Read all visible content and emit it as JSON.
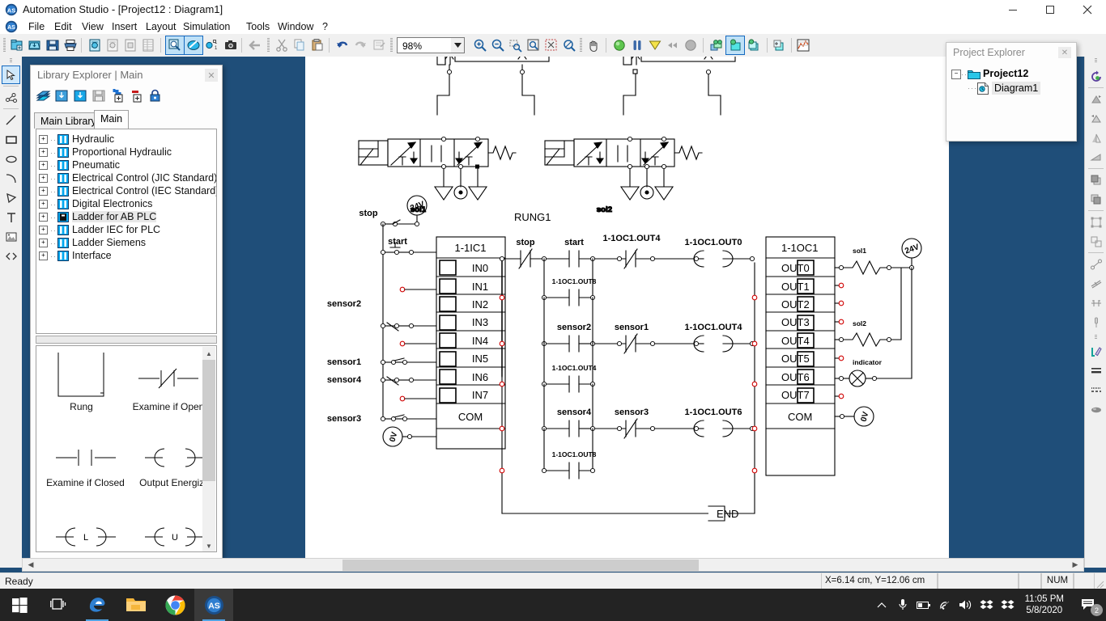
{
  "window": {
    "title": "Automation Studio - [Project12 : Diagram1]",
    "minimize": "–",
    "maximize": "❐",
    "close": "✕"
  },
  "menu": {
    "items": [
      "File",
      "Edit",
      "View",
      "Insert",
      "Layout",
      "Simulation",
      "Tools",
      "Window",
      "?"
    ]
  },
  "toolbar": {
    "zoom_value": "98%",
    "icons": [
      "new-project-icon",
      "open-project-icon",
      "save-icon",
      "print-icon",
      "new-diagram-icon",
      "new-report-icon",
      "new-document-icon",
      "report-table-icon",
      "zoom-preview-icon",
      "edit-mode-icon",
      "variable-manager-icon",
      "snapshot-icon",
      "back-icon",
      "cut-icon",
      "copy-icon",
      "paste-icon",
      "undo-icon",
      "redo-icon",
      "properties-icon",
      "zoom-in-icon",
      "zoom-out-icon",
      "zoom-region-icon",
      "zoom-page-icon",
      "zoom-fit-icon",
      "zoom-select-icon",
      "pan-hand-icon",
      "simulation-normal-icon",
      "simulation-step-icon",
      "simulation-slow-icon",
      "simulation-pause-icon",
      "simulation-stop-icon",
      "sequence-diagram-icon",
      "new-layer-icon",
      "copy-layer-icon",
      "add-layer-icon",
      "plot-graph-icon"
    ]
  },
  "left_tools": {
    "items": [
      {
        "name": "select-arrow-tool",
        "selected": true
      },
      {
        "name": "link-connection-tool",
        "selected": false
      },
      {
        "name": "line-tool",
        "selected": false
      },
      {
        "name": "rectangle-tool",
        "selected": false
      },
      {
        "name": "ellipse-tool",
        "selected": false
      },
      {
        "name": "arc-tool",
        "selected": false
      },
      {
        "name": "polygon-tool",
        "selected": false
      },
      {
        "name": "text-tool",
        "selected": false
      },
      {
        "name": "image-tool",
        "selected": false
      },
      {
        "name": "code-tool",
        "selected": false
      }
    ]
  },
  "right_tools": {
    "items": [
      "refresh-simulation-icon",
      "align-top-icon",
      "align-bottom-icon",
      "flip-vertical-icon",
      "flip-horizontal-icon",
      "bring-front-icon",
      "send-back-icon",
      "group-icon",
      "ungroup-icon",
      "measure-line-icon",
      "parallel-icon",
      "distribute-icon",
      "pin-icon",
      "pen-color-icon",
      "line-weight-icon",
      "line-style-icon",
      "fill-color-icon"
    ]
  },
  "library_explorer": {
    "title": "Library Explorer | Main",
    "close_label": "✕",
    "toolbar_icons": [
      "open-library-icon",
      "import-library-icon",
      "export-library-icon",
      "save-library-icon",
      "add-component-icon",
      "remove-component-icon",
      "lock-library-icon"
    ],
    "tabs": [
      {
        "label": "Main Library",
        "active": false
      },
      {
        "label": "Main",
        "active": true
      }
    ],
    "tree": [
      {
        "label": "Hydraulic",
        "selected": false
      },
      {
        "label": "Proportional Hydraulic",
        "selected": false
      },
      {
        "label": "Pneumatic",
        "selected": false
      },
      {
        "label": "Electrical Control (JIC Standard)",
        "selected": false
      },
      {
        "label": "Electrical Control (IEC Standard)",
        "selected": false
      },
      {
        "label": "Digital Electronics",
        "selected": false
      },
      {
        "label": "Ladder for AB PLC",
        "selected": true
      },
      {
        "label": "Ladder IEC for PLC",
        "selected": false
      },
      {
        "label": "Ladder Siemens",
        "selected": false
      },
      {
        "label": "Interface",
        "selected": false
      }
    ],
    "symbols": [
      {
        "label": "Rung",
        "icon": "rung-symbol"
      },
      {
        "label": "Examine if Open",
        "icon": "examine-if-open-symbol"
      },
      {
        "label": "Examine if Closed",
        "icon": "examine-if-closed-symbol"
      },
      {
        "label": "Output Energize",
        "icon": "output-energize-symbol"
      },
      {
        "label": "L",
        "icon": "output-latch-symbol"
      },
      {
        "label": "U",
        "icon": "output-unlatch-symbol"
      }
    ]
  },
  "project_explorer": {
    "title": "Project Explorer",
    "close_label": "✕",
    "root": "Project12",
    "child": "Diagram1"
  },
  "diagram": {
    "rung_label": "RUNG1",
    "end_label": "END",
    "input_module": {
      "name": "1-1IC1",
      "terminals": [
        "IN0",
        "IN1",
        "IN2",
        "IN3",
        "IN4",
        "IN5",
        "IN6",
        "IN7"
      ],
      "common": "COM",
      "supply_label": "24V",
      "ground_label": "0V"
    },
    "output_module": {
      "name": "1-1OC1",
      "terminals": [
        "OUT0",
        "OUT1",
        "OUT2",
        "OUT3",
        "OUT4",
        "OUT5",
        "OUT6",
        "OUT7"
      ],
      "common": "COM",
      "supply_label": "24V",
      "ground_label": "0V"
    },
    "field_devices": {
      "stop": "stop",
      "start": "start",
      "sensor2": "sensor2",
      "sensor1": "sensor1",
      "sensor4": "sensor4",
      "sensor3": "sensor3"
    },
    "actuators": {
      "sol1": "sol1",
      "sol2": "sol2",
      "indicator": "indicator"
    },
    "valves": [
      {
        "solenoid": "sol1"
      },
      {
        "solenoid": "sol2"
      }
    ],
    "ladder_rungs": [
      {
        "id": "rung-1",
        "series": [
          {
            "label": "stop",
            "type": "examine-if-open"
          },
          {
            "label": "start",
            "type": "examine-if-closed"
          },
          {
            "label": "1-1OC1.OUT4",
            "type": "examine-if-open"
          }
        ],
        "branch": {
          "label": "1-1OC1.OUT0",
          "type": "examine-if-closed"
        },
        "coil": {
          "label": "1-1OC1.OUT0",
          "type": "output-energize"
        }
      },
      {
        "id": "rung-2",
        "series": [
          {
            "label": "sensor2",
            "type": "examine-if-closed"
          },
          {
            "label": "sensor1",
            "type": "examine-if-open"
          }
        ],
        "branch": {
          "label": "1-1OC1.OUT4",
          "type": "examine-if-closed"
        },
        "coil": {
          "label": "1-1OC1.OUT4",
          "type": "output-energize"
        }
      },
      {
        "id": "rung-3",
        "series": [
          {
            "label": "sensor4",
            "type": "examine-if-closed"
          },
          {
            "label": "sensor3",
            "type": "examine-if-open"
          }
        ],
        "branch": {
          "label": "1-1OC1.OUT6",
          "type": "examine-if-closed"
        },
        "coil": {
          "label": "1-1OC1.OUT6",
          "type": "output-energize"
        }
      }
    ]
  },
  "statusbar": {
    "ready": "Ready",
    "coordinates": "X=6.14 cm, Y=12.06 cm",
    "num": "NUM"
  },
  "taskbar": {
    "icons": [
      "windows-start-icon",
      "task-view-icon",
      "edge-browser-icon",
      "file-explorer-icon",
      "chrome-browser-icon",
      "automation-studio-icon"
    ],
    "tray": [
      "show-hidden-icons-chevron",
      "microphone-icon",
      "battery-icon",
      "wifi-icon",
      "volume-icon",
      "dropbox-icon",
      "dropbox-icon-2"
    ],
    "time": "11:05 PM",
    "date": "5/8/2020",
    "notification_count": "2"
  },
  "colors": {
    "accent": "#1f4e79",
    "titlebar_bg": "#ffffff",
    "toolbar_bg": "#f0f0f0",
    "canvas_bg": "#ffffff",
    "node_red": "#e00000",
    "tree_icon_blue": "#00a0ff"
  }
}
